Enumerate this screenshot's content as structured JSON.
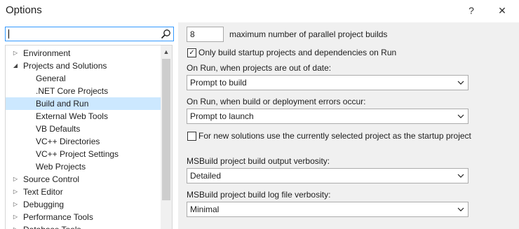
{
  "window": {
    "title": "Options",
    "help_label": "?",
    "close_label": "✕"
  },
  "search": {
    "value": "",
    "placeholder": ""
  },
  "tree": {
    "items": [
      {
        "label": "Environment",
        "twisty": "▷",
        "level": 0,
        "selected": false
      },
      {
        "label": "Projects and Solutions",
        "twisty": "◢",
        "level": 0,
        "selected": false
      },
      {
        "label": "General",
        "twisty": "",
        "level": 1,
        "selected": false
      },
      {
        "label": ".NET Core Projects",
        "twisty": "",
        "level": 1,
        "selected": false
      },
      {
        "label": "Build and Run",
        "twisty": "",
        "level": 1,
        "selected": true
      },
      {
        "label": "External Web Tools",
        "twisty": "",
        "level": 1,
        "selected": false
      },
      {
        "label": "VB Defaults",
        "twisty": "",
        "level": 1,
        "selected": false
      },
      {
        "label": "VC++ Directories",
        "twisty": "",
        "level": 1,
        "selected": false
      },
      {
        "label": "VC++ Project Settings",
        "twisty": "",
        "level": 1,
        "selected": false
      },
      {
        "label": "Web Projects",
        "twisty": "",
        "level": 1,
        "selected": false
      },
      {
        "label": "Source Control",
        "twisty": "▷",
        "level": 0,
        "selected": false
      },
      {
        "label": "Text Editor",
        "twisty": "▷",
        "level": 0,
        "selected": false
      },
      {
        "label": "Debugging",
        "twisty": "▷",
        "level": 0,
        "selected": false
      },
      {
        "label": "Performance Tools",
        "twisty": "▷",
        "level": 0,
        "selected": false
      },
      {
        "label": "Database Tools",
        "twisty": "▷",
        "level": 0,
        "selected": false
      }
    ],
    "scroll_up_glyph": "▲"
  },
  "settings": {
    "parallel_builds": {
      "value": "8",
      "label": "maximum number of parallel project builds"
    },
    "only_startup": {
      "checked": true,
      "check_glyph": "✓",
      "label": "Only build startup projects and dependencies on Run"
    },
    "out_of_date": {
      "label": "On Run, when projects are out of date:",
      "value": "Prompt to build"
    },
    "build_errors": {
      "label": "On Run, when build or deployment errors occur:",
      "value": "Prompt to launch"
    },
    "new_solutions": {
      "checked": false,
      "check_glyph": "",
      "label": "For new solutions use the currently selected project as the startup project"
    },
    "output_verbosity": {
      "label": "MSBuild project build output verbosity:",
      "value": "Detailed"
    },
    "log_verbosity": {
      "label": "MSBuild project build log file verbosity:",
      "value": "Minimal"
    }
  }
}
